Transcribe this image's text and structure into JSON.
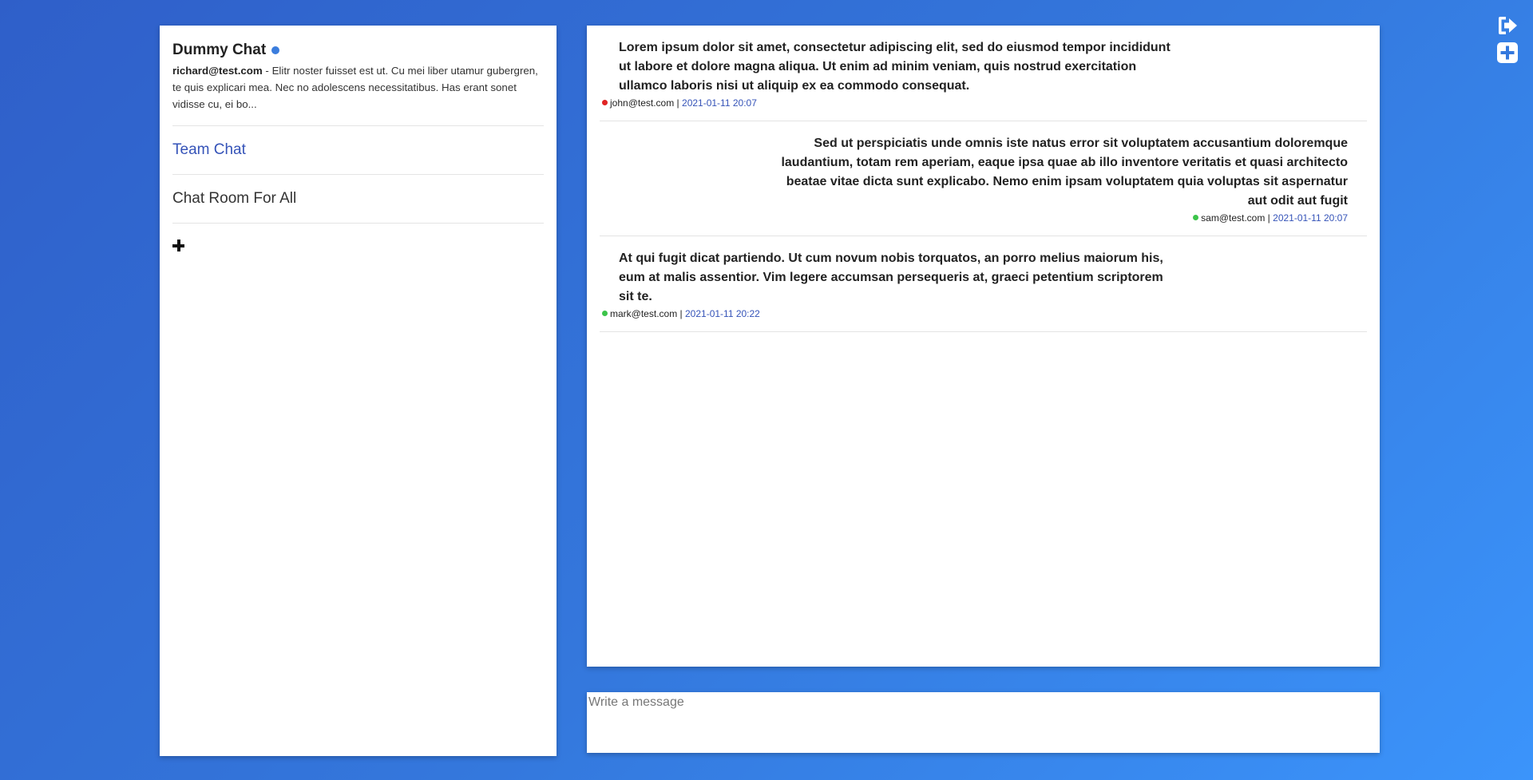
{
  "app": {
    "title": "Dummy Chat",
    "status_color": "#3b7ddd"
  },
  "profile": {
    "email": "richard@test.com",
    "separator": " - ",
    "bio": "Elitr noster fuisset est ut. Cu mei liber utamur gubergren, te quis explicari mea. Nec no adolescens necessitatibus. Has erant sonet vidisse cu, ei bo..."
  },
  "rooms": [
    {
      "label": "Team Chat",
      "active": true
    },
    {
      "label": "Chat Room For All",
      "active": false
    }
  ],
  "add_room_icon": "plus-icon",
  "messages": [
    {
      "text": "Lorem ipsum dolor sit amet, consectetur adipiscing elit, sed do eiusmod tempor incididunt ut labore et dolore magna aliqua. Ut enim ad minim veniam, quis nostrud exercitation ullamco laboris nisi ut aliquip ex ea commodo consequat.",
      "author": "john@test.com",
      "separator": " | ",
      "time": "2021-01-11 20:07",
      "status_color": "#e02424",
      "align": "left"
    },
    {
      "text": "Sed ut perspiciatis unde omnis iste natus error sit voluptatem accusantium doloremque laudantium, totam rem aperiam, eaque ipsa quae ab illo inventore veritatis et quasi architecto beatae vitae dicta sunt explicabo. Nemo enim ipsam voluptatem quia voluptas sit aspernatur aut odit aut fugit",
      "author": "sam@test.com",
      "separator": " | ",
      "time": "2021-01-11 20:07",
      "status_color": "#3cc44a",
      "align": "right"
    },
    {
      "text": "At qui fugit dicat partiendo. Ut cum novum nobis torquatos, an porro melius maiorum his, eum at malis assentior. Vim legere accumsan persequeris at, graeci petentium scriptorem sit te.",
      "author": "mark@test.com",
      "separator": " | ",
      "time": "2021-01-11 20:22",
      "status_color": "#3cc44a",
      "align": "left"
    }
  ],
  "composer": {
    "placeholder": "Write a message",
    "value": ""
  },
  "top_icons": {
    "logout": "logout-icon",
    "add": "plus-square-icon"
  }
}
